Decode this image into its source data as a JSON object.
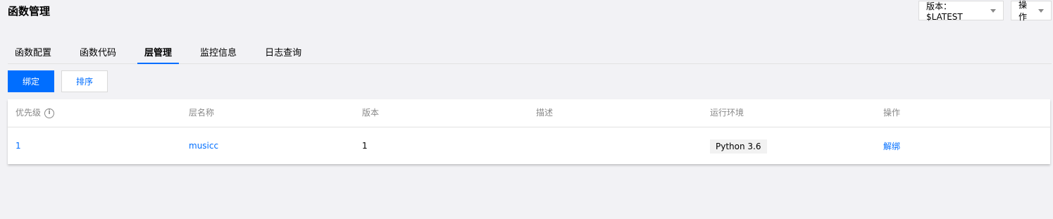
{
  "header": {
    "title": "函数管理",
    "version_dropdown": "版本：$LATEST",
    "ops_dropdown": "操作"
  },
  "tabs": [
    {
      "label": "函数配置"
    },
    {
      "label": "函数代码"
    },
    {
      "label": "层管理",
      "active": true
    },
    {
      "label": "监控信息"
    },
    {
      "label": "日志查询"
    }
  ],
  "actions": {
    "bind": "绑定",
    "sort": "排序"
  },
  "table": {
    "headers": [
      "优先级",
      "层名称",
      "版本",
      "描述",
      "运行环境",
      "操作"
    ],
    "info_glyph": "i",
    "rows": [
      {
        "priority": "1",
        "layer_name": "musicc",
        "version": "1",
        "description": "",
        "runtime": "Python 3.6",
        "action": "解绑"
      }
    ]
  },
  "colors": {
    "accent": "#006eff",
    "background": "#f2f2f5"
  }
}
